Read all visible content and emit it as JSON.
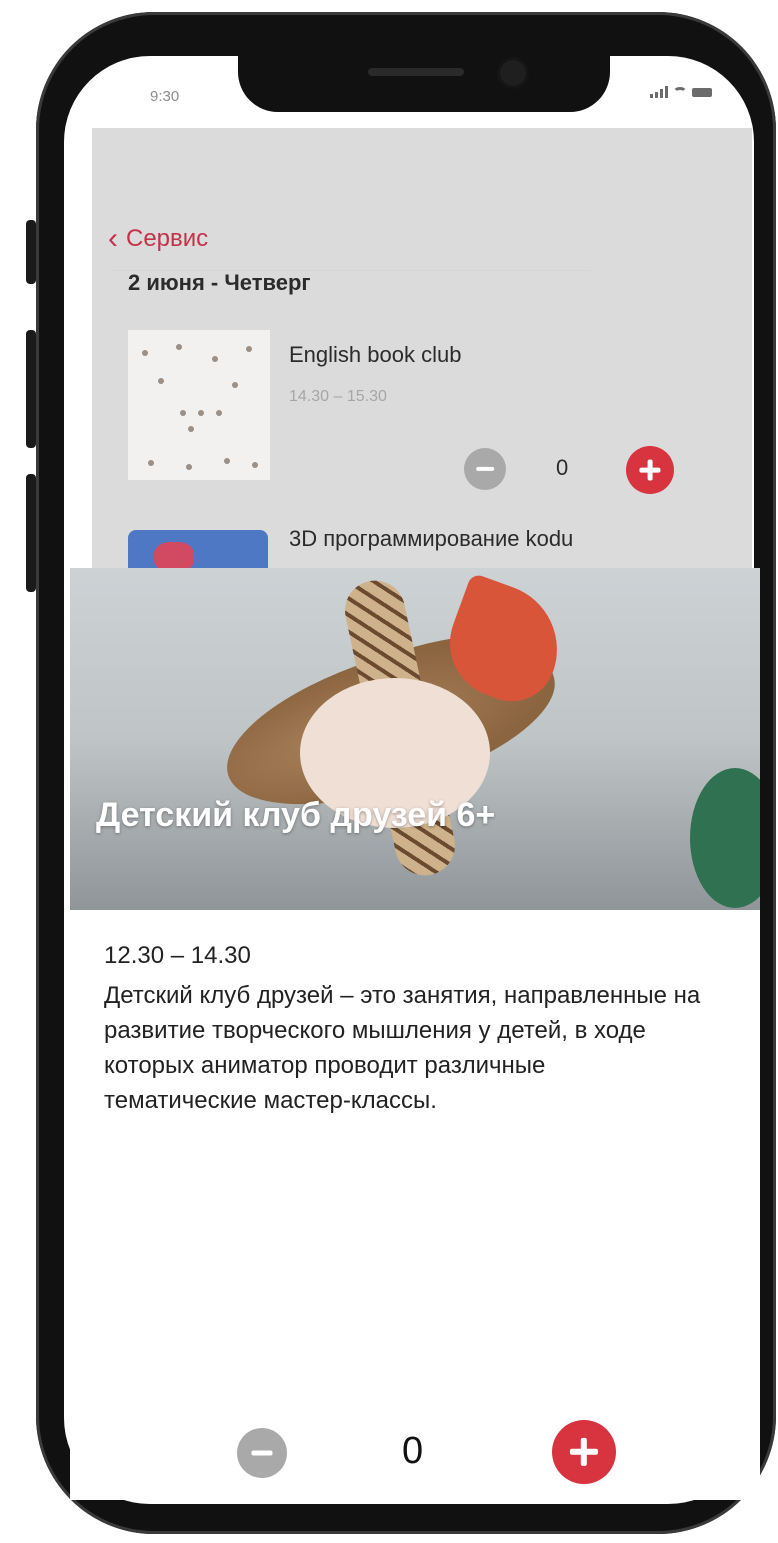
{
  "status_bar": {
    "time": "9:30"
  },
  "background_screen": {
    "back_label": "Сервис",
    "date_header": "2 июня - Четверг",
    "events": [
      {
        "title": "English book club",
        "time": "14.30 – 15.30",
        "count": "0"
      },
      {
        "title": "3D программирование kodu"
      }
    ]
  },
  "detail": {
    "title": "Детский клуб друзей 6+",
    "time": "12.30 – 14.30",
    "description": "Детский клуб друзей – это занятия, направленные на развитие творческого мышления у детей, в ходе которых аниматор проводит различные тематические мастер-классы.",
    "count": "0"
  },
  "colors": {
    "accent": "#d8343f",
    "back_link": "#c3324a",
    "disabled": "#a9a9a9"
  },
  "icons": {
    "back": "chevron-left-icon",
    "minus": "minus-circle-icon",
    "plus": "plus-circle-icon",
    "signal": "signal-icon",
    "wifi": "wifi-icon",
    "battery": "battery-icon"
  }
}
